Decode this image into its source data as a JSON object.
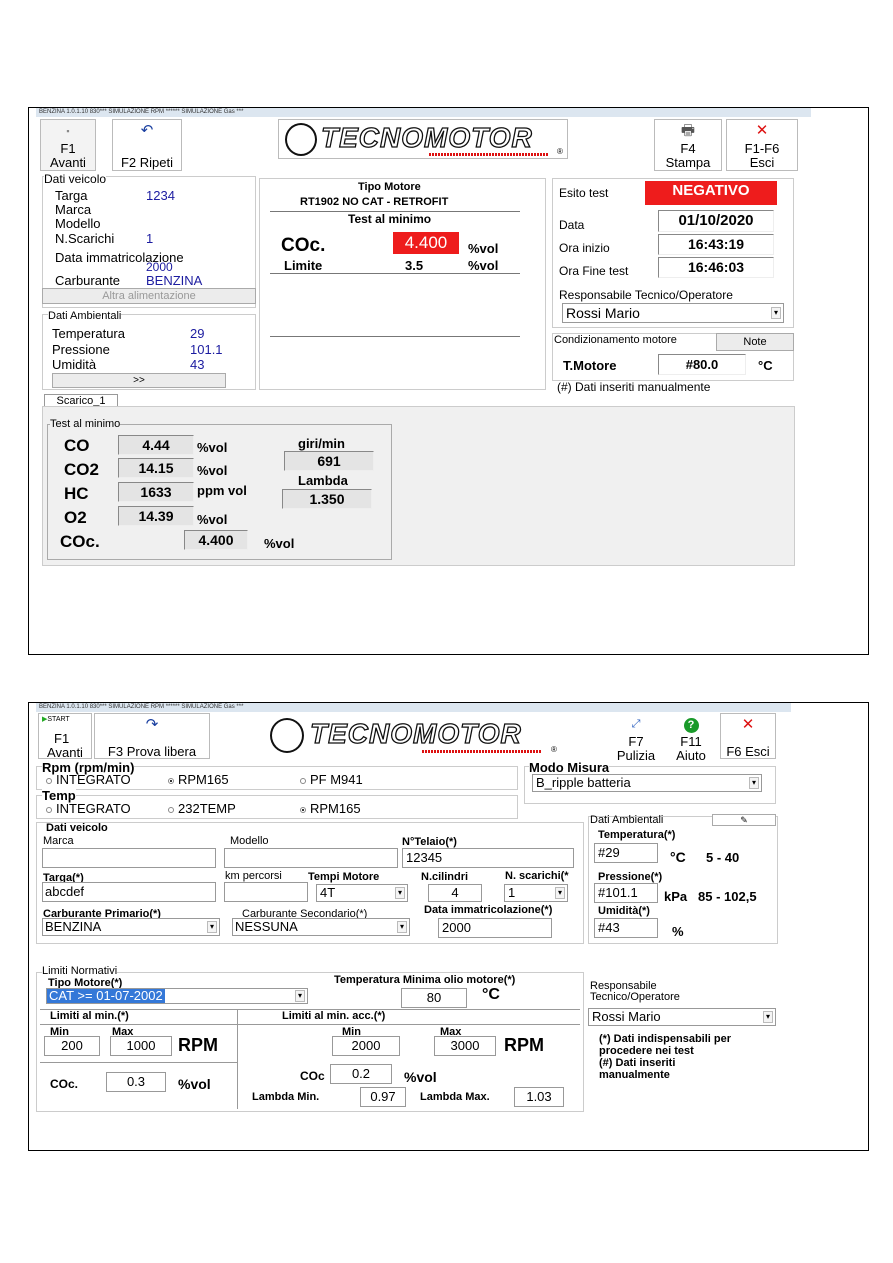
{
  "s1": {
    "titlebar": "BENZINA 1.0.1.10  830*** SIMULAZIONE RPM ****** SIMULAZIONE Gas ***",
    "toolbar": {
      "f1_key": "F1",
      "f1_label": "Avanti",
      "f2_label": "F2 Ripeti",
      "f4_key": "F4",
      "f4_label": "Stampa",
      "f1f6_key": "F1-F6",
      "f1f6_label": "Esci"
    },
    "logo": "TECNOMOTOR",
    "logo_mark": "®",
    "vehicle": {
      "title": "Dati veicolo",
      "targa_label": "Targa",
      "targa_value": "1234",
      "marca_label": "Marca",
      "modello_label": "Modello",
      "scarichi_label": "N.Scarichi",
      "scarichi_value": "1",
      "data_label": "Data immatricolazione",
      "data_value": "2000",
      "carb_label": "Carburante",
      "carb_value": "BENZINA",
      "altra_button": "Altra alimentazione"
    },
    "ambient": {
      "title": "Dati Ambientali",
      "temp_label": "Temperatura",
      "temp_value": "29",
      "press_label": "Pressione",
      "press_value": "101.1",
      "umid_label": "Umidità",
      "umid_value": "43",
      "more_button": ">>"
    },
    "center": {
      "tipo_label": "Tipo Motore",
      "tipo_value": "RT1902 NO CAT - RETROFIT",
      "test_title": "Test al minimo",
      "coc_label": "COc.",
      "coc_value": "4.400",
      "coc_unit": "%vol",
      "limite_label": "Limite",
      "limite_value": "3.5",
      "limite_unit": "%vol"
    },
    "esito": {
      "label": "Esito test",
      "value": "NEGATIVO",
      "data_label": "Data",
      "data_value": "01/10/2020",
      "inizio_label": "Ora inizio",
      "inizio_value": "16:43:19",
      "fine_label": "Ora Fine test",
      "fine_value": "16:46:03",
      "resp_label": "Responsabile Tecnico/Operatore",
      "resp_value": "Rossi Mario",
      "cond_label": "Condizionamento motore",
      "note_button": "Note",
      "tmot_label": "T.Motore",
      "tmot_value": "#80.0",
      "tmot_unit": "°C",
      "footnote": "(#) Dati inseriti manualmente"
    },
    "tab_label": "Scarico_1",
    "minimo": {
      "title": "Test al minimo",
      "rows": [
        {
          "label": "CO",
          "value": "4.44",
          "unit": "%vol"
        },
        {
          "label": "CO2",
          "value": "14.15",
          "unit": "%vol"
        },
        {
          "label": "HC",
          "value": "1633",
          "unit": "ppm vol"
        },
        {
          "label": "O2",
          "value": "14.39",
          "unit": "%vol"
        }
      ],
      "coc_label": "COc.",
      "coc_value": "4.400",
      "coc_unit": "%vol",
      "giri_label": "giri/min",
      "giri_value": "691",
      "lambda_label": "Lambda",
      "lambda_value": "1.350"
    }
  },
  "s2": {
    "titlebar": "BENZINA 1.0.1.10  830*** SIMULAZIONE RPM ****** SIMULAZIONE Gas ***",
    "toolbar": {
      "start_badge": "START",
      "f1_key": "F1",
      "f1_label": "Avanti",
      "f3_label": "F3 Prova libera",
      "f7_key": "F7",
      "f7_label": "Pulizia",
      "f11_key": "F11",
      "f11_label": "Aiuto",
      "f6_label": "F6 Esci"
    },
    "logo": "TECNOMOTOR",
    "logo_mark": "®",
    "rpm": {
      "title": "Rpm (rpm/min)",
      "opt1": "INTEGRATO",
      "opt2": "RPM165",
      "opt3": "PF M941"
    },
    "temp": {
      "title": "Temp",
      "opt1": "INTEGRATO",
      "opt2": "232TEMP",
      "opt3": "RPM165"
    },
    "modo": {
      "title": "Modo Misura",
      "value": "B_ripple batteria"
    },
    "vehicle": {
      "title": "Dati veicolo",
      "marca_label": "Marca",
      "modello_label": "Modello",
      "telaio_label": "N°Telaio(*)",
      "telaio_value": "12345",
      "targa_label": "Targa(*)",
      "targa_value": "abcdef",
      "km_label": "km percorsi",
      "tempi_label": "Tempi Motore",
      "tempi_value": "4T",
      "cil_label": "N.cilindri",
      "cil_value": "4",
      "scar_label": "N. scarichi(*",
      "scar_value": "1",
      "carb1_label": "Carburante Primario(*)",
      "carb1_value": "BENZINA",
      "carb2_label": "Carburante Secondario(*)",
      "carb2_value": "NESSUNA",
      "data_label": "Data immatricolazione(*)",
      "data_value": "2000"
    },
    "ambient": {
      "title": "Dati Ambientali",
      "temp_label": "Temperatura(*)",
      "temp_value": "#29",
      "temp_unit": "°C",
      "temp_range": "5 - 40",
      "press_label": "Pressione(*)",
      "press_value": "#101.1",
      "press_unit": "kPa",
      "press_range": "85 - 102,5",
      "umid_label": "Umidità(*)",
      "umid_value": "#43",
      "umid_unit": "%"
    },
    "limits": {
      "title": "Limiti Normativi",
      "tipo_label": "Tipo Motore(*)",
      "tipo_value": "CAT >= 01-07-2002",
      "tolio_label": "Temperatura Minima olio motore(*)",
      "tolio_value": "80",
      "tolio_unit": "°C",
      "min_title": "Limiti al min.(*)",
      "minacc_title": "Limiti al min. acc.(*)",
      "min_label": "Min",
      "max_label": "Max",
      "min_min": "200",
      "min_max": "1000",
      "rpm_unit": "RPM",
      "acc_min": "2000",
      "acc_max": "3000",
      "coc_label": "COc.",
      "coc_value": "0.3",
      "coc_unit": "%vol",
      "coc2_label": "COc",
      "coc2_value": "0.2",
      "coc2_unit": "%vol",
      "lmin_label": "Lambda Min.",
      "lmin_value": "0.97",
      "lmax_label": "Lambda Max.",
      "lmax_value": "1.03"
    },
    "resp": {
      "label1": "Responsabile",
      "label2": "Tecnico/Operatore",
      "value": "Rossi Mario",
      "note1": "(*) Dati indispensabili per procedere nei test",
      "note2": "(#) Dati inseriti manualmente"
    }
  }
}
